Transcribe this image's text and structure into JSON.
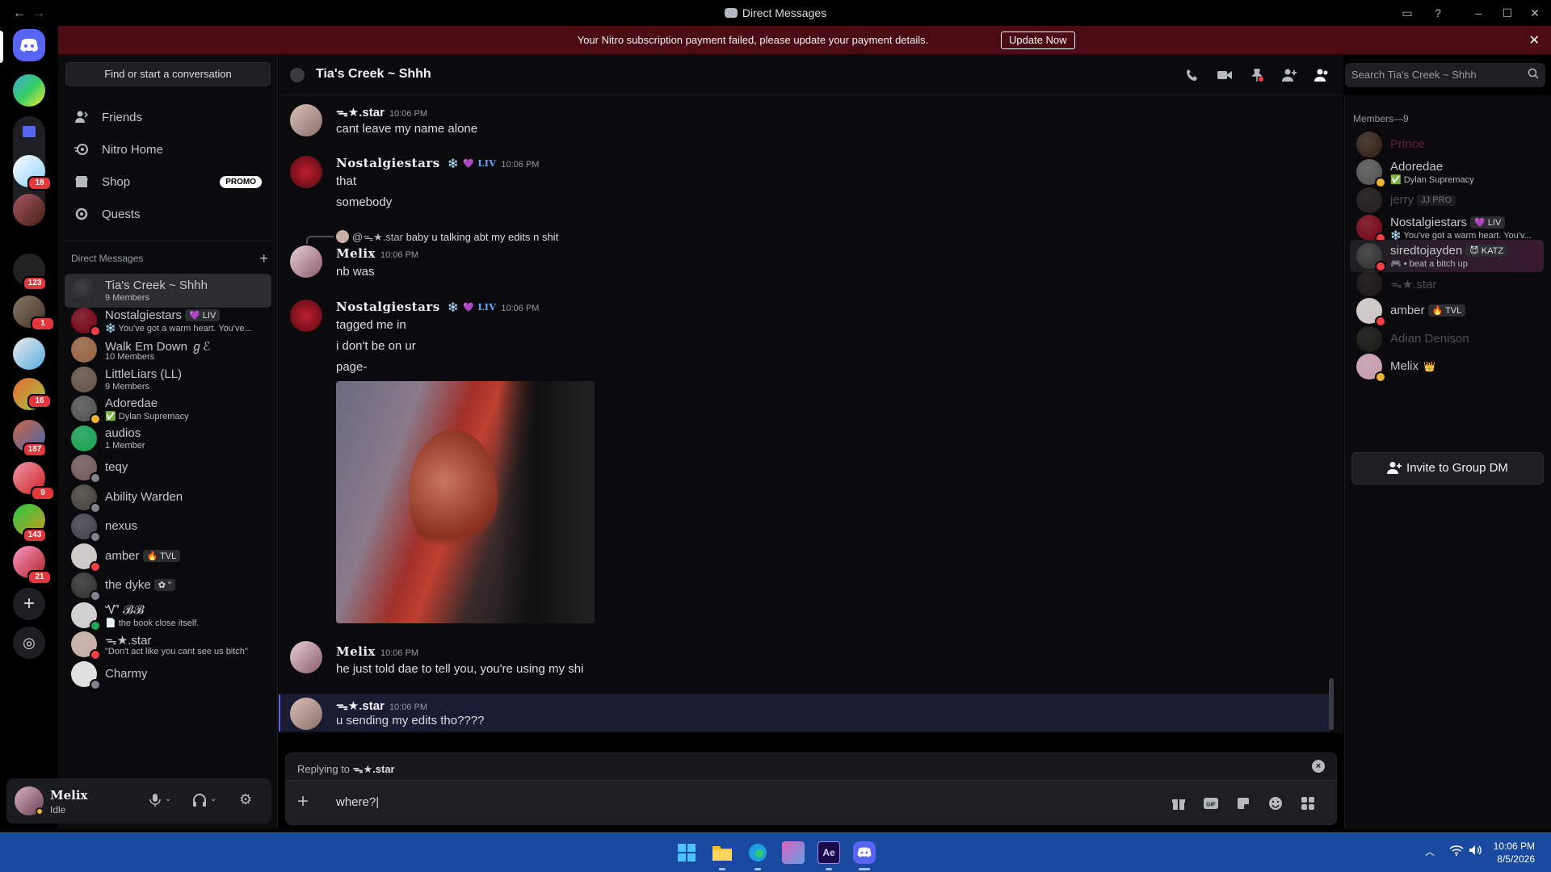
{
  "window": {
    "title": "Direct Messages"
  },
  "banner": {
    "message": "Your Nitro subscription payment failed, please update your payment details.",
    "button": "Update Now"
  },
  "rail_badges": [
    "18",
    "123",
    "1",
    "16",
    "187",
    "9",
    "143",
    "21"
  ],
  "sidebar": {
    "find_placeholder": "Find or start a conversation",
    "nav": [
      {
        "label": "Friends",
        "icon": "friends-icon"
      },
      {
        "label": "Nitro Home",
        "icon": "nitro-icon"
      },
      {
        "label": "Shop",
        "icon": "shop-icon",
        "badge": "PROMO"
      },
      {
        "label": "Quests",
        "icon": "quests-icon"
      }
    ],
    "dm_header": "Direct Messages",
    "dms": [
      {
        "name": "Tia's Creek ~ Shhh",
        "sub": "9 Members",
        "selected": true,
        "color": "#2a2a30"
      },
      {
        "name": "Nostalgiestars",
        "tag": "💜 LIV",
        "sub": "❄️ You've got a warm heart. You've...",
        "status": "#f23f43",
        "color": "#7a1020"
      },
      {
        "name": "Walk Em Down ℊℰ",
        "sub": "10 Members",
        "color": "#9a6a4a"
      },
      {
        "name": "LittleLiars (LL)",
        "sub": "9 Members",
        "color": "#6a5a50"
      },
      {
        "name": "Adoredae",
        "sub": "✅ Dylan Supremacy",
        "status": "#f0b232",
        "color": "#5a5a5a"
      },
      {
        "name": "audios",
        "sub": "1 Member",
        "color": "#23a55a"
      },
      {
        "name": "teqy",
        "status": "#80848e",
        "color": "#7a6060"
      },
      {
        "name": "Ability Warden",
        "status": "#80848e",
        "color": "#504a44"
      },
      {
        "name": "nexus",
        "status": "#80848e",
        "color": "#4a4a56"
      },
      {
        "name": "amber",
        "tag": "🔥 TVL",
        "status": "#f23f43",
        "color": "#d0c8c8"
      },
      {
        "name": "the dyke",
        "tag": "✿ \"",
        "status": "#80848e",
        "color": "#3a3a3a"
      },
      {
        "name": "Ꮙ 𝓑𝓑",
        "sub": "📄 the book close itself.",
        "status": "#23a55a",
        "color": "#d0d0d0"
      },
      {
        "name": "ᯓ★.star",
        "sub": "\"Don't act like you cant see us bitch\"",
        "status": "#f23f43",
        "color": "#c8b0a8"
      },
      {
        "name": "Charmy",
        "status": "#80848e",
        "color": "#e0e0e0"
      }
    ]
  },
  "user": {
    "name": "Melix",
    "status": "Idle"
  },
  "chat": {
    "title": "Tia's Creek ~ Shhh",
    "search_placeholder": "Search Tia's Creek ~ Shhh",
    "messages": [
      {
        "author": "ᯓ★.star",
        "time": "10:06 PM",
        "lines": [
          "cant leave my name alone"
        ]
      },
      {
        "author": "Nostalgiestars",
        "badges": "❄️ 💜 LIV",
        "time": "10:06 PM",
        "lines": [
          "that",
          "somebody"
        ]
      },
      {
        "reply_to": "@ᯓ★.star",
        "reply_text": "baby u talking abt my edits n shit",
        "author": "Melix",
        "time": "10:06 PM",
        "lines": [
          "nb was"
        ]
      },
      {
        "author": "Nostalgiestars",
        "badges": "❄️ 💜 LIV",
        "time": "10:06 PM",
        "lines": [
          "tagged me in",
          "i don't be on ur",
          "page-"
        ]
      },
      {
        "author": "Melix",
        "time": "10:06 PM",
        "lines": [
          "he just told dae to tell you, you're using my shi"
        ]
      },
      {
        "author": "ᯓ★.star",
        "time": "10:06 PM",
        "lines": [
          "u sending my edits tho????"
        ]
      }
    ],
    "replying_label": "Replying to",
    "replying_to": "ᯓ★.star",
    "draft": "where?"
  },
  "members": {
    "header": "Members—9",
    "list": [
      {
        "name": "Prince",
        "style": "prince",
        "color": "#3a2a20"
      },
      {
        "name": "Adoredae",
        "sub": "✅ Dylan Supremacy",
        "status": "#f0b232",
        "color": "#5a5a5a"
      },
      {
        "name": "jerry",
        "tag": "JJ PRO",
        "dim": true,
        "color": "#4a4040"
      },
      {
        "name": "Nostalgiestars",
        "tag": "💜 LIV",
        "sub": "❄️ You've got a warm heart. You'v...",
        "status": "#f23f43",
        "color": "#7a1020"
      },
      {
        "name": "siredtojayden",
        "tag": "😈 KATZ",
        "sub": "🎮 • beat a bitch up",
        "status": "#f23f43",
        "color": "#3a3a3a",
        "highlight": true
      },
      {
        "name": "ᯓ★.star",
        "dim": true,
        "color": "#3a3030"
      },
      {
        "name": "amber",
        "tag": "🔥 TVL",
        "status": "#f23f43",
        "color": "#d0c8c8"
      },
      {
        "name": "Adian Denison",
        "dim": true,
        "color": "#3a3a30"
      },
      {
        "name": "Melix",
        "crown": "👑",
        "status": "#f0b232",
        "color": "#c8a0b0"
      }
    ],
    "invite": "Invite to Group DM"
  },
  "taskbar": {
    "time": "10:06 PM",
    "date": "8/5/2026"
  }
}
